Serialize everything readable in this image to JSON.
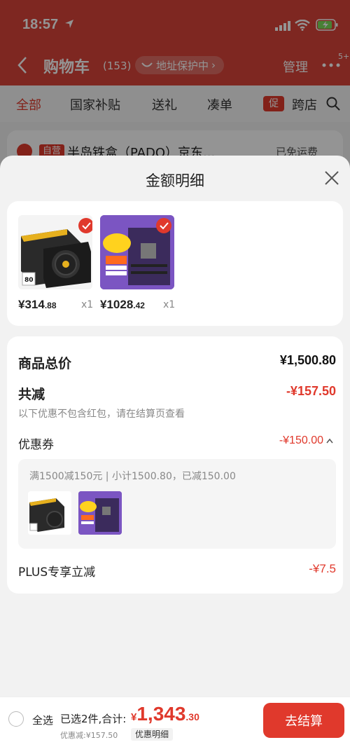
{
  "status_bar": {
    "time": "18:57"
  },
  "nav": {
    "title": "购物车",
    "count": "(153)",
    "address": "地址保护中",
    "manage": "管理",
    "more_badge": "5+"
  },
  "tabs": [
    "全部",
    "国家补贴",
    "送礼",
    "凑单",
    "跨店"
  ],
  "tab_badge": "促",
  "background_store": {
    "tag": "自营",
    "name": "半岛铁盒（PADO）京东...",
    "shipping": "已免运费"
  },
  "sheet": {
    "title": "金额明细",
    "products": [
      {
        "price_int": "¥314",
        "price_dec": ".88",
        "qty": "x1"
      },
      {
        "price_int": "¥1028",
        "price_dec": ".42",
        "qty": "x1"
      }
    ],
    "goods_total_label": "商品总价",
    "goods_total": "¥1,500.80",
    "discount_label": "共减",
    "discount_total": "-¥157.50",
    "discount_note": "以下优惠不包含红包，请在结算页查看",
    "coupon_label": "优惠券",
    "coupon_value": "-¥150.00",
    "coupon_detail": "满1500减150元 | 小计1500.80，已减150.00",
    "plus_label": "PLUS专享立减",
    "plus_value": "-¥7.5"
  },
  "bottom_bar": {
    "select_all": "全选",
    "selected": "已选2件,合计:",
    "total_symbol": "¥",
    "total_int": "1,343",
    "total_dec": ".30",
    "discount_line": "优惠减:¥157.50",
    "detail_chip": "优惠明细",
    "checkout": "去结算"
  },
  "colors": {
    "accent": "#e0392c",
    "header": "#d9443a"
  }
}
